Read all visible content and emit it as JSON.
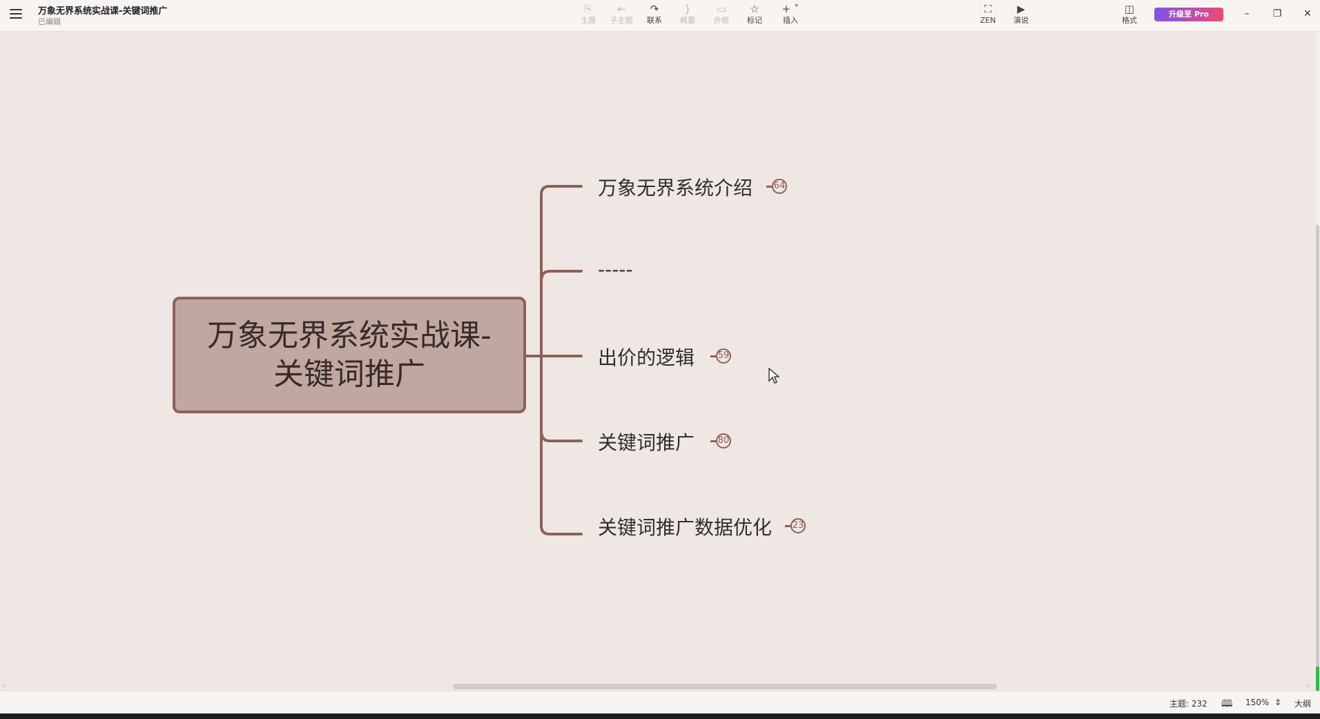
{
  "header": {
    "menu_icon": "hamburger-menu-icon",
    "title": "万象无界系统实战课-关键词推广",
    "status": "已编辑"
  },
  "toolbar": {
    "topic": {
      "label": "主题",
      "icon": "topic-icon",
      "enabled": false
    },
    "subtopic": {
      "label": "子主题",
      "icon": "subtopic-icon",
      "enabled": false
    },
    "relationship": {
      "label": "联系",
      "icon": "relationship-curve-icon",
      "enabled": true
    },
    "summary": {
      "label": "概要",
      "icon": "summary-bracket-icon",
      "enabled": false
    },
    "boundary": {
      "label": "外框",
      "icon": "boundary-icon",
      "enabled": false
    },
    "marker": {
      "label": "标记",
      "icon": "star-icon",
      "enabled": true
    },
    "insert": {
      "label": "插入",
      "icon": "plus-icon",
      "enabled": true
    },
    "zen": {
      "label": "ZEN",
      "icon": "fullscreen-icon"
    },
    "pitch": {
      "label": "演说",
      "icon": "presentation-play-icon"
    },
    "format": {
      "label": "格式",
      "icon": "format-panel-icon"
    },
    "upgrade": {
      "label": "升级至 Pro"
    }
  },
  "mindmap": {
    "central_topic": {
      "line1": "万象无界系统实战课-",
      "line2": "关键词推广"
    },
    "branches": [
      {
        "label": "万象无界系统介绍",
        "badge": "64"
      },
      {
        "label": "-----",
        "badge": ""
      },
      {
        "label": "出价的逻辑",
        "badge": "59"
      },
      {
        "label": "关键词推广",
        "badge": "80"
      },
      {
        "label": "关键词推广数据优化",
        "badge": "23"
      }
    ],
    "colors": {
      "central_fill": "#c0a7a0",
      "branch_line": "#8e5f59",
      "canvas_bg": "#efe7e4"
    }
  },
  "statusbar": {
    "topic_count": "主题: 232",
    "book_icon": "book-icon",
    "zoom": "150%",
    "outline": "大纲"
  }
}
